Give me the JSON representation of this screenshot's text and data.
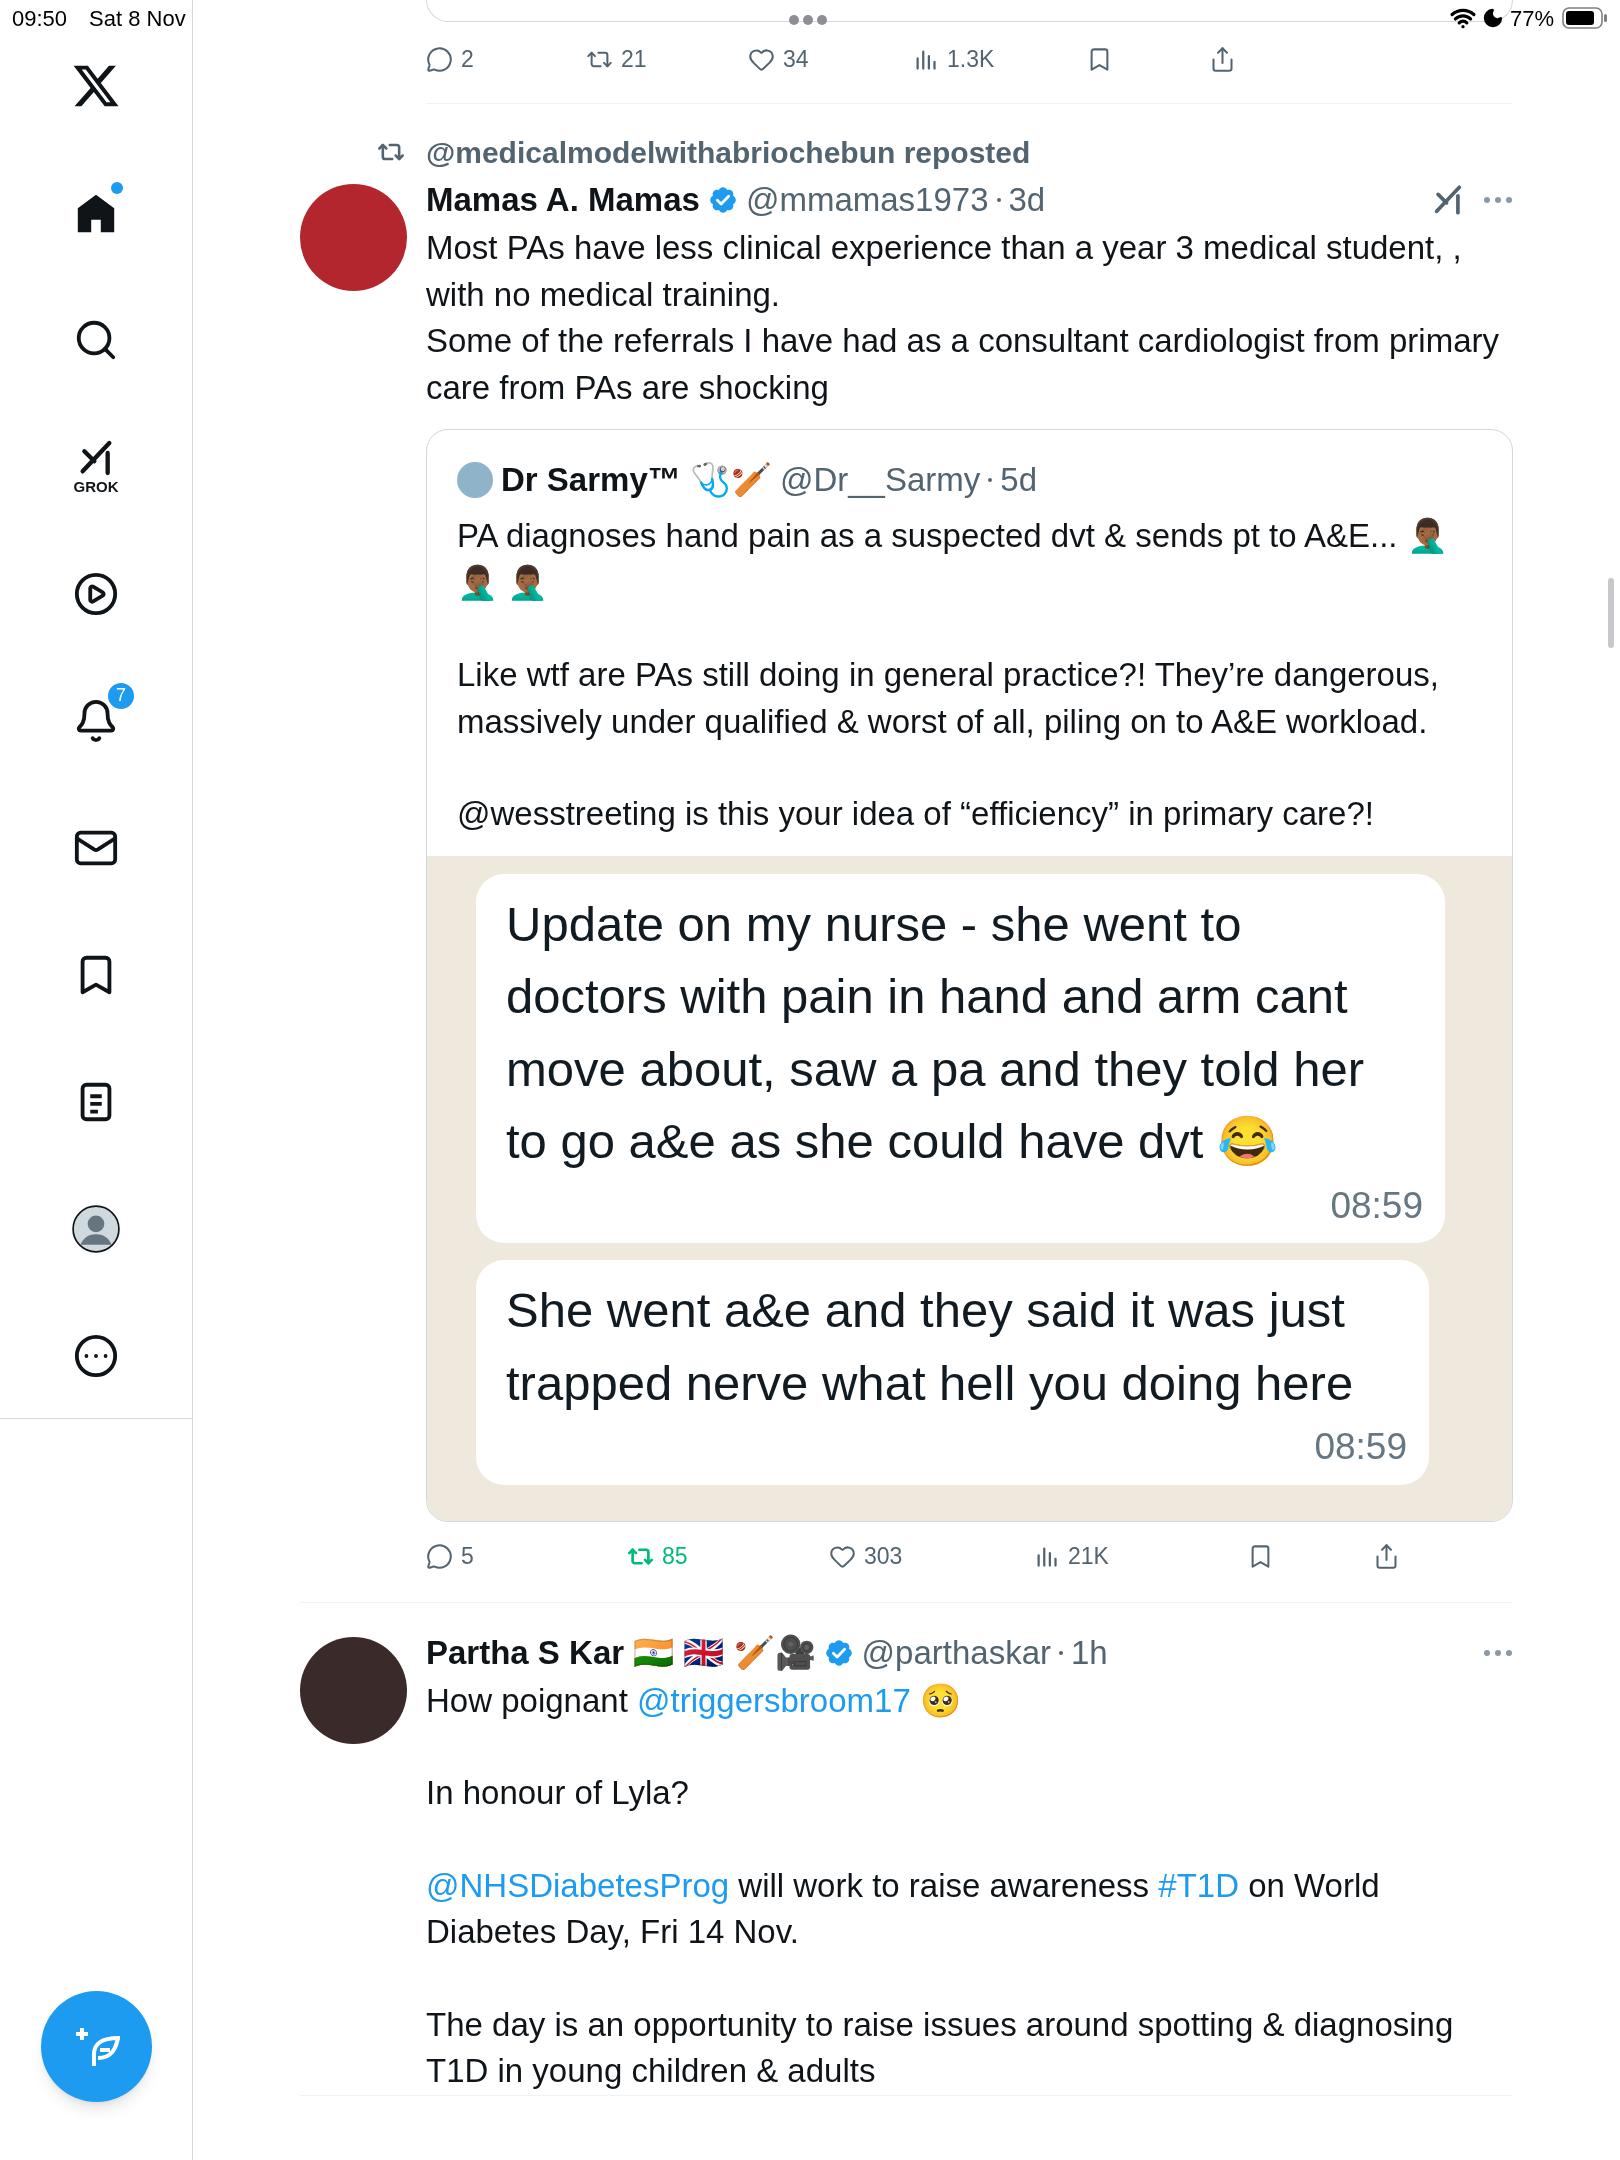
{
  "status_bar": {
    "time": "09:50",
    "date": "Sat 8 Nov",
    "battery": "77%"
  },
  "sidebar": {
    "items": [
      {
        "kind": "logo",
        "selected": false
      },
      {
        "kind": "home",
        "selected": true,
        "dot": true
      },
      {
        "kind": "search",
        "selected": false
      },
      {
        "kind": "grok",
        "selected": false,
        "label": "GROK"
      },
      {
        "kind": "video",
        "selected": false
      },
      {
        "kind": "notifications",
        "selected": false,
        "badge": "7"
      },
      {
        "kind": "messages",
        "selected": false
      },
      {
        "kind": "bookmarks",
        "selected": false
      },
      {
        "kind": "lists",
        "selected": false
      },
      {
        "kind": "profile",
        "selected": false
      },
      {
        "kind": "more",
        "selected": false
      }
    ]
  },
  "previous_tweet": {
    "stats": [
      {
        "kind": "reply",
        "count": "2",
        "active": false
      },
      {
        "kind": "repost",
        "count": "21",
        "active": false
      },
      {
        "kind": "like",
        "count": "34",
        "active": false
      },
      {
        "kind": "views",
        "count": "1.3K",
        "active": false
      },
      {
        "kind": "bookmark",
        "active": false
      },
      {
        "kind": "share",
        "active": false
      }
    ]
  },
  "tweets": [
    {
      "repost_by": "@medicalmodelwithabriochebun reposted",
      "name": "Mamas A. Mamas",
      "verified": true,
      "handle": "@mmamas1973",
      "time": "3d",
      "grok": true,
      "paragraphs": [
        [
          {
            "kind": "text",
            "text": "Most PAs have less clinical experience than a year 3 medical student, , with no medical training.\nSome of the referrals I have had as a consultant cardiologist from primary care from PAs are shocking"
          }
        ]
      ],
      "quote": {
        "name": "Dr Sarmy™ 🩺🏏",
        "handle": "@Dr__Sarmy",
        "time": "5d",
        "paragraphs": [
          [
            {
              "kind": "text",
              "text": "PA diagnoses hand pain as a suspected dvt & sends pt to A&E... 🤦🏾‍♂️ 🤦🏾‍♂️ 🤦🏾‍♂️"
            }
          ],
          [
            {
              "kind": "text",
              "text": "Like wtf are PAs still doing in general practice?! They’re dangerous, massively under qualified & worst of all, piling on to A&E workload."
            }
          ],
          [
            {
              "kind": "text",
              "text": "@wesstreeting is this your idea of “efficiency” in primary care?!"
            }
          ]
        ],
        "chat": [
          {
            "text": "Update on my nurse - she went to doctors with pain in hand and arm cant move about, saw a pa and they told her to go a&e as she could have dvt 😂",
            "time": "08:59"
          },
          {
            "text": "She went a&e and they said it was just trapped nerve what hell you doing here",
            "time": "08:59"
          }
        ]
      },
      "stats": [
        {
          "kind": "reply",
          "count": "5",
          "active": false
        },
        {
          "kind": "repost",
          "count": "85",
          "active": true
        },
        {
          "kind": "like",
          "count": "303",
          "active": false
        },
        {
          "kind": "views",
          "count": "21K",
          "active": false
        },
        {
          "kind": "bookmark",
          "active": false
        },
        {
          "kind": "share",
          "active": false
        }
      ]
    },
    {
      "name": "Partha S Kar 🇮🇳 🇬🇧 🏏🎥",
      "verified": true,
      "handle": "@parthaskar",
      "time": "1h",
      "grok": false,
      "paragraphs": [
        [
          {
            "kind": "text",
            "text": "How poignant "
          },
          {
            "kind": "link",
            "text": "@triggersbroom17"
          },
          {
            "kind": "text",
            "text": " 🥺"
          }
        ],
        [
          {
            "kind": "text",
            "text": "In honour of Lyla?"
          }
        ],
        [
          {
            "kind": "link",
            "text": "@NHSDiabetesProg"
          },
          {
            "kind": "text",
            "text": " will work to raise awareness "
          },
          {
            "kind": "link",
            "text": "#T1D"
          },
          {
            "kind": "text",
            "text": " on World Diabetes Day, Fri 14 Nov."
          }
        ],
        [
          {
            "kind": "text",
            "text": "The day is an opportunity to raise issues around spotting & diagnosing T1D in young children & adults"
          }
        ]
      ]
    }
  ]
}
